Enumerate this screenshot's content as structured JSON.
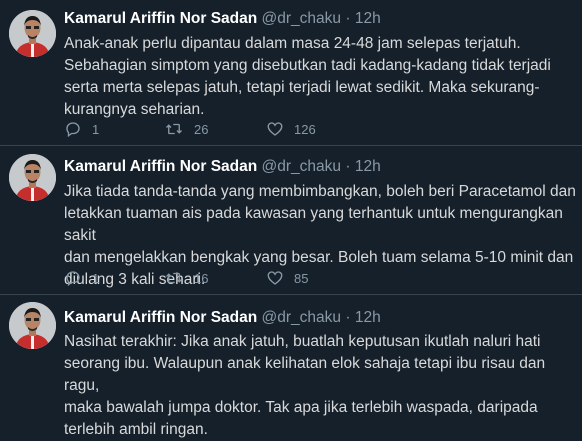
{
  "tweets": [
    {
      "name": "Kamarul Ariffin Nor Sadan",
      "handle": "@dr_chaku",
      "separator": "·",
      "time": "12h",
      "text": "Anak-anak perlu dipantau dalam masa 24-48 jam selepas terjatuh.\nSebahagian simptom yang disebutkan tadi kadang-kadang tidak terjadi\nserta merta selepas jatuh, tetapi terjadi lewat sedikit. Maka sekurang-\nkurangnya seharian.",
      "replies": "1",
      "retweets": "26",
      "likes": "126"
    },
    {
      "name": "Kamarul Ariffin Nor Sadan",
      "handle": "@dr_chaku",
      "separator": "·",
      "time": "12h",
      "text": "Jika tiada tanda-tanda yang membimbangkan, boleh beri Paracetamol dan\nletakkan tuaman ais pada kawasan yang terhantuk untuk mengurangkan sakit\ndan mengelakkan bengkak yang besar. Boleh tuam selama 5-10 minit dan\ndiulang 3 kali sehari.",
      "replies": "1",
      "retweets": "16",
      "likes": "85"
    },
    {
      "name": "Kamarul Ariffin Nor Sadan",
      "handle": "@dr_chaku",
      "separator": "·",
      "time": "12h",
      "text": "Nasihat terakhir: Jika anak jatuh, buatlah keputusan ikutlah naluri hati\nseorang ibu. Walaupun anak kelihatan elok sahaja tetapi ibu risau dan ragu,\nmaka bawalah jumpa doktor. Tak apa jika terlebih waspada, daripada\nterlebih ambil ringan."
    }
  ],
  "icons": {
    "reply": "reply-icon",
    "retweet": "retweet-icon",
    "like": "heart-icon"
  },
  "colors": {
    "background": "#15202b",
    "muted": "#8899a6",
    "divider": "#38444d"
  }
}
